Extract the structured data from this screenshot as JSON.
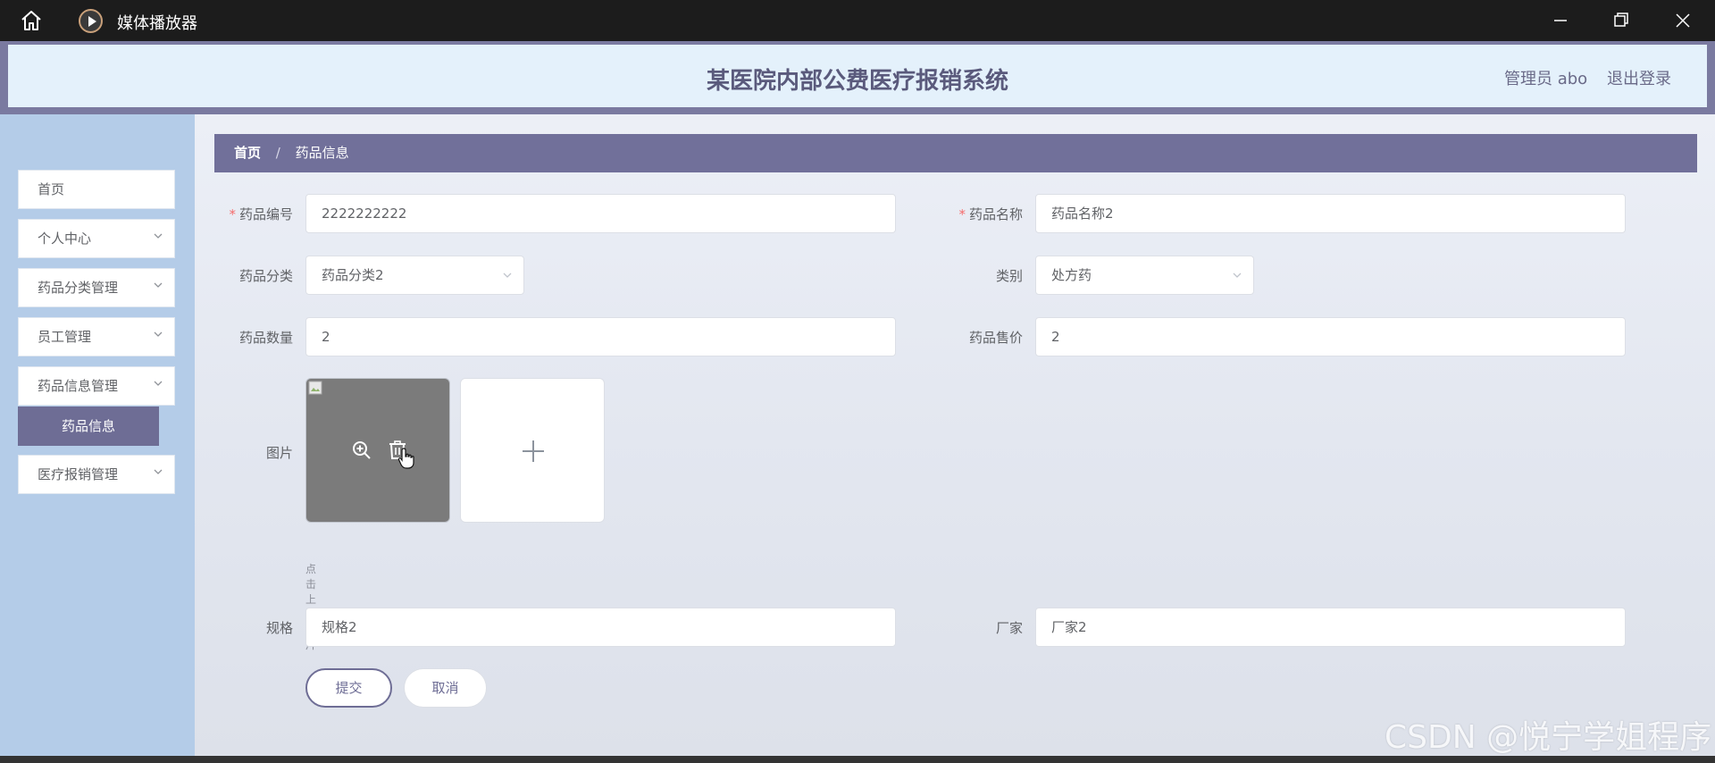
{
  "window": {
    "title": "媒体播放器"
  },
  "header": {
    "system_title": "某医院内部公费医疗报销系统",
    "user": "管理员 abo",
    "logout": "退出登录"
  },
  "sidebar": {
    "items": [
      {
        "label": "首页"
      },
      {
        "label": "个人中心"
      },
      {
        "label": "药品分类管理"
      },
      {
        "label": "员工管理"
      },
      {
        "label": "药品信息管理"
      },
      {
        "label": "医疗报销管理"
      }
    ],
    "active_sub": "药品信息"
  },
  "breadcrumb": {
    "home": "首页",
    "separator": "/",
    "current": "药品信息"
  },
  "form": {
    "drug_code": {
      "label": "药品编号",
      "value": "2222222222"
    },
    "drug_name": {
      "label": "药品名称",
      "value": "药品名称2"
    },
    "drug_category": {
      "label": "药品分类",
      "value": "药品分类2"
    },
    "type": {
      "label": "类别",
      "value": "处方药"
    },
    "quantity": {
      "label": "药品数量",
      "value": "2"
    },
    "price": {
      "label": "药品售价",
      "value": "2"
    },
    "image": {
      "label": "图片",
      "tip": "点击上传图片"
    },
    "spec": {
      "label": "规格",
      "value": "规格2"
    },
    "manufacturer": {
      "label": "厂家",
      "value": "厂家2"
    },
    "submit": "提交",
    "cancel": "取消"
  },
  "watermark": "CSDN @悦宁学姐程序",
  "colors": {
    "accent": "#6e6d95",
    "sidebar_bg": "#b4cce8",
    "header_bg": "#e4f1fb",
    "required": "#f56c6c"
  }
}
